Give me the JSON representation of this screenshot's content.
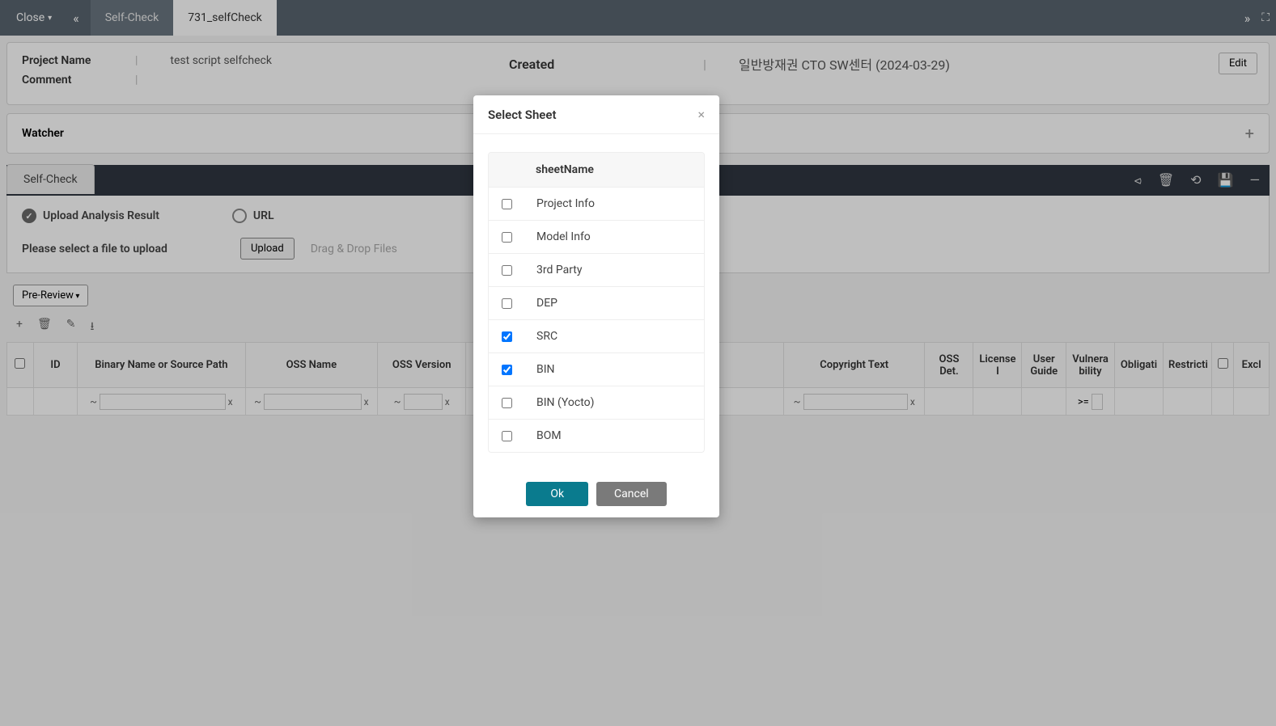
{
  "topbar": {
    "close": "Close",
    "tabs": [
      {
        "label": "Self-Check",
        "active": false
      },
      {
        "label": "731_selfCheck",
        "active": true
      }
    ]
  },
  "info": {
    "projectName": {
      "label": "Project Name",
      "value": "test script selfcheck"
    },
    "created": {
      "label": "Created",
      "value": "일반방재권 CTO SW센터 (2024-03-29)"
    },
    "comment": {
      "label": "Comment",
      "value": ""
    },
    "editBtn": "Edit"
  },
  "watcher": {
    "label": "Watcher"
  },
  "section": {
    "tab": "Self-Check"
  },
  "upload": {
    "radio1": "Upload Analysis Result",
    "radio2": "URL",
    "selectLabel": "Please select a file to upload",
    "uploadBtn": "Upload",
    "dragText": "Drag & Drop Files"
  },
  "prereview": "Pre-Review",
  "table": {
    "headers": [
      "",
      "ID",
      "Binary Name or Source Path",
      "OSS Name",
      "OSS Version",
      "",
      "",
      "Copyright Text",
      "OSS Det.",
      "License I",
      "User Guide",
      "Vulnera bility",
      "Obligati",
      "Restricti",
      "",
      "Excl"
    ],
    "filter_ge": ">="
  },
  "modal": {
    "title": "Select Sheet",
    "header": "sheetName",
    "sheets": [
      {
        "name": "Project Info",
        "checked": false
      },
      {
        "name": "Model Info",
        "checked": false
      },
      {
        "name": "3rd Party",
        "checked": false
      },
      {
        "name": "DEP",
        "checked": false
      },
      {
        "name": "SRC",
        "checked": true
      },
      {
        "name": "BIN",
        "checked": true
      },
      {
        "name": "BIN (Yocto)",
        "checked": false
      },
      {
        "name": "BOM",
        "checked": false
      }
    ],
    "ok": "Ok",
    "cancel": "Cancel"
  }
}
